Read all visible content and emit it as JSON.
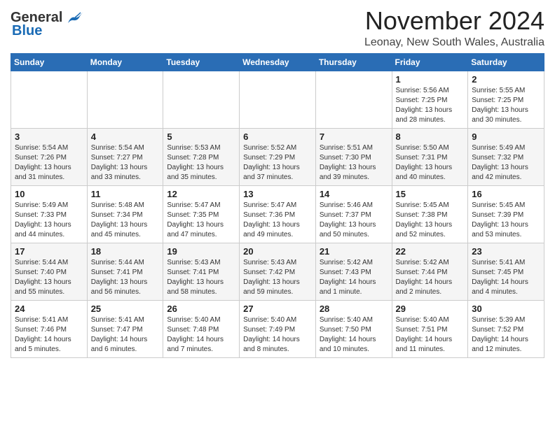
{
  "header": {
    "logo_general": "General",
    "logo_blue": "Blue",
    "month_title": "November 2024",
    "location": "Leonay, New South Wales, Australia"
  },
  "columns": [
    "Sunday",
    "Monday",
    "Tuesday",
    "Wednesday",
    "Thursday",
    "Friday",
    "Saturday"
  ],
  "weeks": [
    {
      "cells": [
        {
          "day": "",
          "info": ""
        },
        {
          "day": "",
          "info": ""
        },
        {
          "day": "",
          "info": ""
        },
        {
          "day": "",
          "info": ""
        },
        {
          "day": "",
          "info": ""
        },
        {
          "day": "1",
          "info": "Sunrise: 5:56 AM\nSunset: 7:25 PM\nDaylight: 13 hours\nand 28 minutes."
        },
        {
          "day": "2",
          "info": "Sunrise: 5:55 AM\nSunset: 7:25 PM\nDaylight: 13 hours\nand 30 minutes."
        }
      ]
    },
    {
      "cells": [
        {
          "day": "3",
          "info": "Sunrise: 5:54 AM\nSunset: 7:26 PM\nDaylight: 13 hours\nand 31 minutes."
        },
        {
          "day": "4",
          "info": "Sunrise: 5:54 AM\nSunset: 7:27 PM\nDaylight: 13 hours\nand 33 minutes."
        },
        {
          "day": "5",
          "info": "Sunrise: 5:53 AM\nSunset: 7:28 PM\nDaylight: 13 hours\nand 35 minutes."
        },
        {
          "day": "6",
          "info": "Sunrise: 5:52 AM\nSunset: 7:29 PM\nDaylight: 13 hours\nand 37 minutes."
        },
        {
          "day": "7",
          "info": "Sunrise: 5:51 AM\nSunset: 7:30 PM\nDaylight: 13 hours\nand 39 minutes."
        },
        {
          "day": "8",
          "info": "Sunrise: 5:50 AM\nSunset: 7:31 PM\nDaylight: 13 hours\nand 40 minutes."
        },
        {
          "day": "9",
          "info": "Sunrise: 5:49 AM\nSunset: 7:32 PM\nDaylight: 13 hours\nand 42 minutes."
        }
      ]
    },
    {
      "cells": [
        {
          "day": "10",
          "info": "Sunrise: 5:49 AM\nSunset: 7:33 PM\nDaylight: 13 hours\nand 44 minutes."
        },
        {
          "day": "11",
          "info": "Sunrise: 5:48 AM\nSunset: 7:34 PM\nDaylight: 13 hours\nand 45 minutes."
        },
        {
          "day": "12",
          "info": "Sunrise: 5:47 AM\nSunset: 7:35 PM\nDaylight: 13 hours\nand 47 minutes."
        },
        {
          "day": "13",
          "info": "Sunrise: 5:47 AM\nSunset: 7:36 PM\nDaylight: 13 hours\nand 49 minutes."
        },
        {
          "day": "14",
          "info": "Sunrise: 5:46 AM\nSunset: 7:37 PM\nDaylight: 13 hours\nand 50 minutes."
        },
        {
          "day": "15",
          "info": "Sunrise: 5:45 AM\nSunset: 7:38 PM\nDaylight: 13 hours\nand 52 minutes."
        },
        {
          "day": "16",
          "info": "Sunrise: 5:45 AM\nSunset: 7:39 PM\nDaylight: 13 hours\nand 53 minutes."
        }
      ]
    },
    {
      "cells": [
        {
          "day": "17",
          "info": "Sunrise: 5:44 AM\nSunset: 7:40 PM\nDaylight: 13 hours\nand 55 minutes."
        },
        {
          "day": "18",
          "info": "Sunrise: 5:44 AM\nSunset: 7:41 PM\nDaylight: 13 hours\nand 56 minutes."
        },
        {
          "day": "19",
          "info": "Sunrise: 5:43 AM\nSunset: 7:41 PM\nDaylight: 13 hours\nand 58 minutes."
        },
        {
          "day": "20",
          "info": "Sunrise: 5:43 AM\nSunset: 7:42 PM\nDaylight: 13 hours\nand 59 minutes."
        },
        {
          "day": "21",
          "info": "Sunrise: 5:42 AM\nSunset: 7:43 PM\nDaylight: 14 hours\nand 1 minute."
        },
        {
          "day": "22",
          "info": "Sunrise: 5:42 AM\nSunset: 7:44 PM\nDaylight: 14 hours\nand 2 minutes."
        },
        {
          "day": "23",
          "info": "Sunrise: 5:41 AM\nSunset: 7:45 PM\nDaylight: 14 hours\nand 4 minutes."
        }
      ]
    },
    {
      "cells": [
        {
          "day": "24",
          "info": "Sunrise: 5:41 AM\nSunset: 7:46 PM\nDaylight: 14 hours\nand 5 minutes."
        },
        {
          "day": "25",
          "info": "Sunrise: 5:41 AM\nSunset: 7:47 PM\nDaylight: 14 hours\nand 6 minutes."
        },
        {
          "day": "26",
          "info": "Sunrise: 5:40 AM\nSunset: 7:48 PM\nDaylight: 14 hours\nand 7 minutes."
        },
        {
          "day": "27",
          "info": "Sunrise: 5:40 AM\nSunset: 7:49 PM\nDaylight: 14 hours\nand 8 minutes."
        },
        {
          "day": "28",
          "info": "Sunrise: 5:40 AM\nSunset: 7:50 PM\nDaylight: 14 hours\nand 10 minutes."
        },
        {
          "day": "29",
          "info": "Sunrise: 5:40 AM\nSunset: 7:51 PM\nDaylight: 14 hours\nand 11 minutes."
        },
        {
          "day": "30",
          "info": "Sunrise: 5:39 AM\nSunset: 7:52 PM\nDaylight: 14 hours\nand 12 minutes."
        }
      ]
    }
  ]
}
